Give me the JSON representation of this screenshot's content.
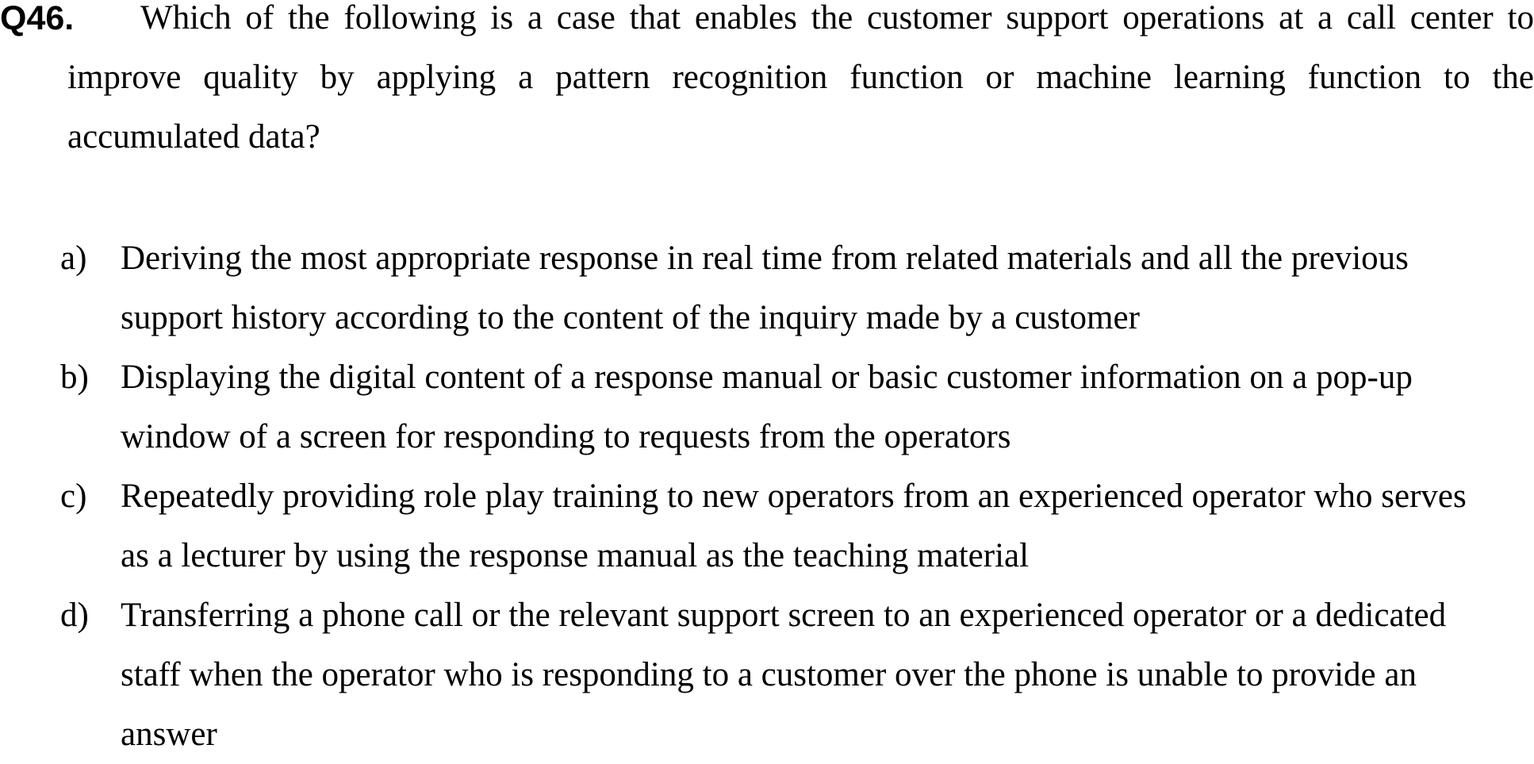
{
  "question": {
    "number": "Q46.",
    "text": "Which of the following is a case that enables the customer support operations at a call center to improve quality by applying a pattern recognition function or machine learning function to the accumulated data?"
  },
  "options": [
    {
      "letter": "a)",
      "text": "Deriving the most appropriate response in real time from related materials and all the previous support history according to the content of the inquiry made by a customer"
    },
    {
      "letter": "b)",
      "text": "Displaying the digital content of a response manual or basic customer information on a pop-up window of a screen for responding to requests from the operators"
    },
    {
      "letter": "c)",
      "text": "Repeatedly providing role play training to new operators from an experienced operator who serves as a lecturer by using the response manual as the teaching material"
    },
    {
      "letter": "d)",
      "text": "Transferring a phone call or the relevant support screen to an experienced operator or a dedicated staff when the operator who is responding to a customer over the phone is unable to provide an answer"
    }
  ]
}
